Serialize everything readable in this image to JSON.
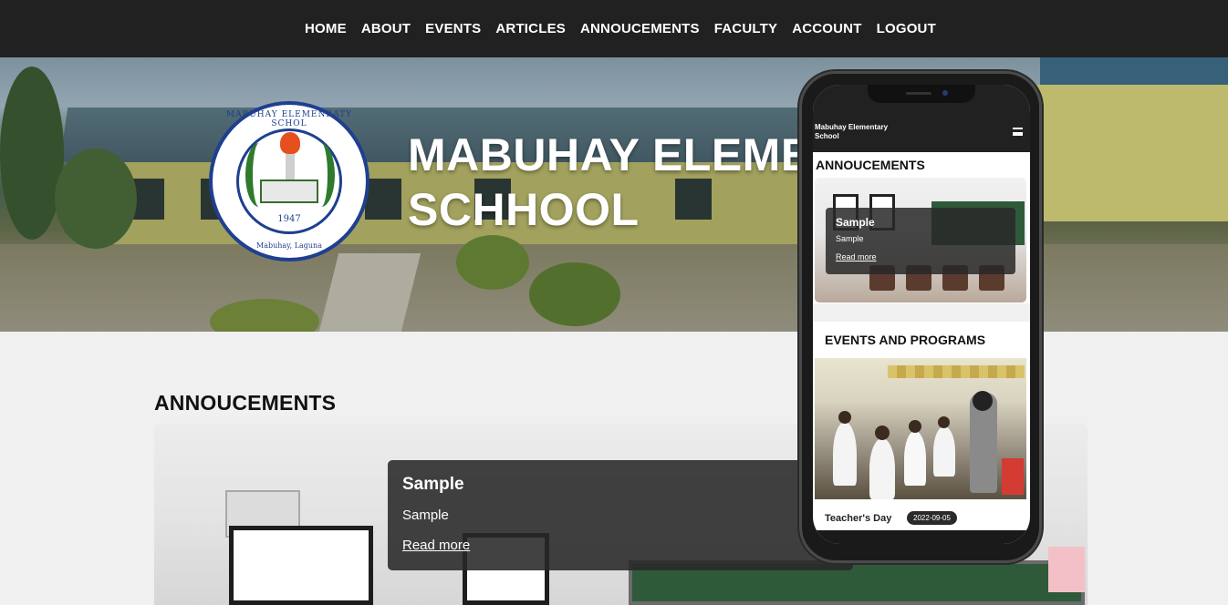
{
  "nav": {
    "items": [
      "HOME",
      "ABOUT",
      "EVENTS",
      "ARTICLES",
      "ANNOUCEMENTS",
      "FACULTY",
      "ACCOUNT",
      "LOGOUT"
    ]
  },
  "hero": {
    "title_line1": "MABUHAY ELEMENTARY",
    "title_line2": "SCHHOOL",
    "logo": {
      "top_text": "MABUHAY ELEMENRATY SCHOL",
      "year": "1947",
      "bottom_text": "Mabuhay, Laguna"
    }
  },
  "announcements": {
    "title": "ANNOUCEMENTS",
    "card": {
      "title": "Sample",
      "description": "Sample",
      "link": "Read more"
    }
  },
  "mobile": {
    "brand_line1": "Mabuhay Elementary",
    "brand_line2": "School",
    "announcements_title": "ANNOUCEMENTS",
    "ann_card": {
      "title": "Sample",
      "description": "Sample",
      "link": "Read more"
    },
    "events_title": "EVENTS AND PROGRAMS",
    "event": {
      "name": "Teacher's Day",
      "date": "2022-09-05"
    }
  },
  "colors": {
    "nav_bg": "#212121",
    "page_bg": "#f0f0f0",
    "overlay": "#282828"
  }
}
